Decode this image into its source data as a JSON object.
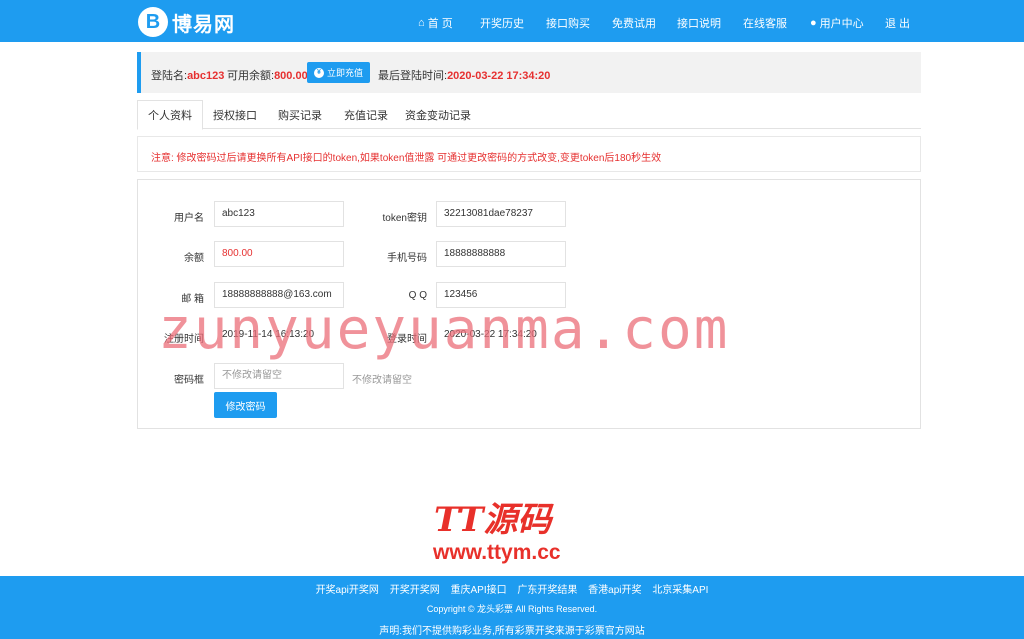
{
  "header": {
    "logo_mark": "B",
    "logo_text": "博易网",
    "nav": [
      {
        "label": "首 页",
        "icon": "home-icon"
      },
      {
        "label": "开奖历史"
      },
      {
        "label": "接口购买"
      },
      {
        "label": "免费试用"
      },
      {
        "label": "接口说明"
      },
      {
        "label": "在线客服"
      },
      {
        "label": "用户中心",
        "icon": "user-icon"
      },
      {
        "label": "退 出"
      }
    ]
  },
  "infobar": {
    "login_label": "登陆名:",
    "login_value": "abc123",
    "balance_label": "可用余额:",
    "balance_value": "800.00",
    "recharge_label": "立即充值",
    "last_login_label": "最后登陆时间:",
    "last_login_value": "2020-03-22 17:34:20"
  },
  "tabs": [
    "个人资料",
    "授权接口",
    "购买记录",
    "充值记录",
    "资金变动记录"
  ],
  "notice": "注意: 修改密码过后请更换所有API接口的token,如果token值泄露 可通过更改密码的方式改变,变更token后180秒生效",
  "form": {
    "username_label": "用户名",
    "username_value": "abc123",
    "token_label": "token密钥",
    "token_value": "32213081dae78237",
    "balance_label": "余额",
    "balance_value": "800.00",
    "phone_label": "手机号码",
    "phone_value": "18888888888",
    "email_label": "邮 箱",
    "email_value": "18888888888@163.com",
    "qq_label": "Q Q",
    "qq_value": "123456",
    "reg_label": "注册时间",
    "reg_value": "2019-11-14 16:13:20",
    "login_label": "登录时间",
    "login_value": "2020-03-22 17:34:20",
    "password_label": "密码框",
    "password_placeholder": "不修改请留空",
    "password_hint": "不修改请留空",
    "submit_label": "修改密码"
  },
  "watermark": {
    "big": "zunyueyuanma.com",
    "logo": "TT源码",
    "url": "www.ttym.cc"
  },
  "footer": {
    "links": [
      "开奖api开奖网",
      "开奖开奖网",
      "重庆API接口",
      "广东开奖结果",
      "香港api开奖",
      "北京采集API"
    ],
    "copyright": "Copyright © 龙头彩票 All Rights Reserved.",
    "note": "声明:我们不提供购彩业务,所有彩票开奖来源于彩票官方网站"
  },
  "colors": {
    "brand": "#1e9cf0",
    "accent_red": "#e63030"
  }
}
